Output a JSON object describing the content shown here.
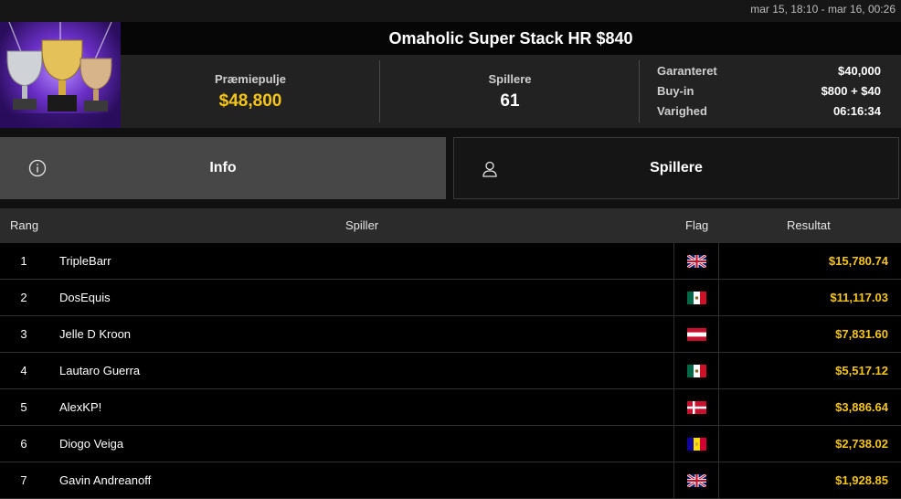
{
  "dates": "mar 15, 18:10 - mar 16, 00:26",
  "tournament": {
    "title": "Omaholic Super Stack HR $840",
    "prizepool_label": "Præmiepulje",
    "prizepool_value": "$48,800",
    "players_label": "Spillere",
    "players_value": "61",
    "details": [
      {
        "label": "Garanteret",
        "value": "$40,000"
      },
      {
        "label": "Buy-in",
        "value": "$800 + $40"
      },
      {
        "label": "Varighed",
        "value": "06:16:34"
      }
    ]
  },
  "tabs": {
    "info": "Info",
    "players": "Spillere"
  },
  "table": {
    "headers": {
      "rank": "Rang",
      "player": "Spiller",
      "flag": "Flag",
      "result": "Resultat"
    },
    "rows": [
      {
        "rank": "1",
        "player": "TripleBarr",
        "flag": "gb-flag",
        "result": "$15,780.74"
      },
      {
        "rank": "2",
        "player": "DosEquis",
        "flag": "mx-flag",
        "result": "$11,117.03"
      },
      {
        "rank": "3",
        "player": "Jelle D Kroon",
        "flag": "at-flag",
        "result": "$7,831.60"
      },
      {
        "rank": "4",
        "player": "Lautaro Guerra",
        "flag": "mx-flag",
        "result": "$5,517.12"
      },
      {
        "rank": "5",
        "player": "AlexKP!",
        "flag": "dk-flag",
        "result": "$3,886.64"
      },
      {
        "rank": "6",
        "player": "Diogo Veiga",
        "flag": "ad-flag",
        "result": "$2,738.02"
      },
      {
        "rank": "7",
        "player": "Gavin Andreanoff",
        "flag": "gb-flag",
        "result": "$1,928.85"
      }
    ]
  },
  "colors": {
    "accent_gold": "#f5c518",
    "active_tab": "#474747"
  }
}
